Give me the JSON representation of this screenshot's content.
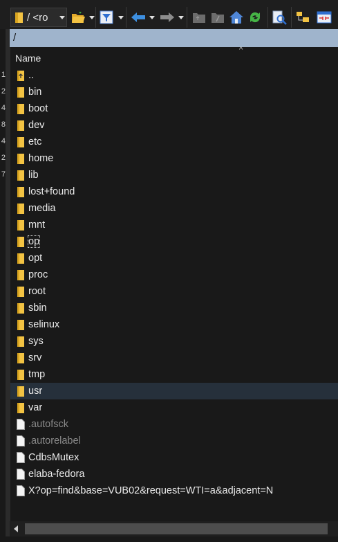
{
  "toolbar": {
    "drive_label": "/ <ro",
    "icons": [
      "folder-icon",
      "open-folder-icon",
      "filter-icon",
      "back-arrow-icon",
      "forward-arrow-icon",
      "folder-up-icon",
      "folder-root-icon",
      "home-icon",
      "refresh-icon",
      "find-files-icon",
      "tree-view-icon",
      "compare-icon"
    ]
  },
  "left_panel": {
    "row_numbers": [
      "1",
      "2",
      "4",
      "8",
      "4",
      "2",
      "7"
    ]
  },
  "path": "/",
  "list": {
    "column_name": "Name",
    "sort_indicator": "^",
    "items": [
      {
        "name": "..",
        "type": "updir"
      },
      {
        "name": "bin",
        "type": "folder"
      },
      {
        "name": "boot",
        "type": "folder"
      },
      {
        "name": "dev",
        "type": "folder"
      },
      {
        "name": "etc",
        "type": "folder"
      },
      {
        "name": "home",
        "type": "folder"
      },
      {
        "name": "lib",
        "type": "folder"
      },
      {
        "name": "lost+found",
        "type": "folder"
      },
      {
        "name": "media",
        "type": "folder"
      },
      {
        "name": "mnt",
        "type": "folder"
      },
      {
        "name": "op",
        "type": "folder",
        "focused": true
      },
      {
        "name": "opt",
        "type": "folder"
      },
      {
        "name": "proc",
        "type": "folder"
      },
      {
        "name": "root",
        "type": "folder"
      },
      {
        "name": "sbin",
        "type": "folder"
      },
      {
        "name": "selinux",
        "type": "folder"
      },
      {
        "name": "sys",
        "type": "folder"
      },
      {
        "name": "srv",
        "type": "folder"
      },
      {
        "name": "tmp",
        "type": "folder"
      },
      {
        "name": "usr",
        "type": "folder",
        "highlighted": true
      },
      {
        "name": "var",
        "type": "folder"
      },
      {
        "name": ".autofsck",
        "type": "file",
        "hidden": true
      },
      {
        "name": ".autorelabel",
        "type": "file",
        "hidden": true
      },
      {
        "name": "CdbsMutex",
        "type": "file"
      },
      {
        "name": "elaba-fedora",
        "type": "file"
      },
      {
        "name": "X?op=find&base=VUB02&request=WTI=a&adjacent=N",
        "type": "file"
      }
    ]
  },
  "colors": {
    "path_bar": "#9fb4cc",
    "folder": "#f3c343",
    "highlight": "#26303b",
    "background": "#191919"
  }
}
